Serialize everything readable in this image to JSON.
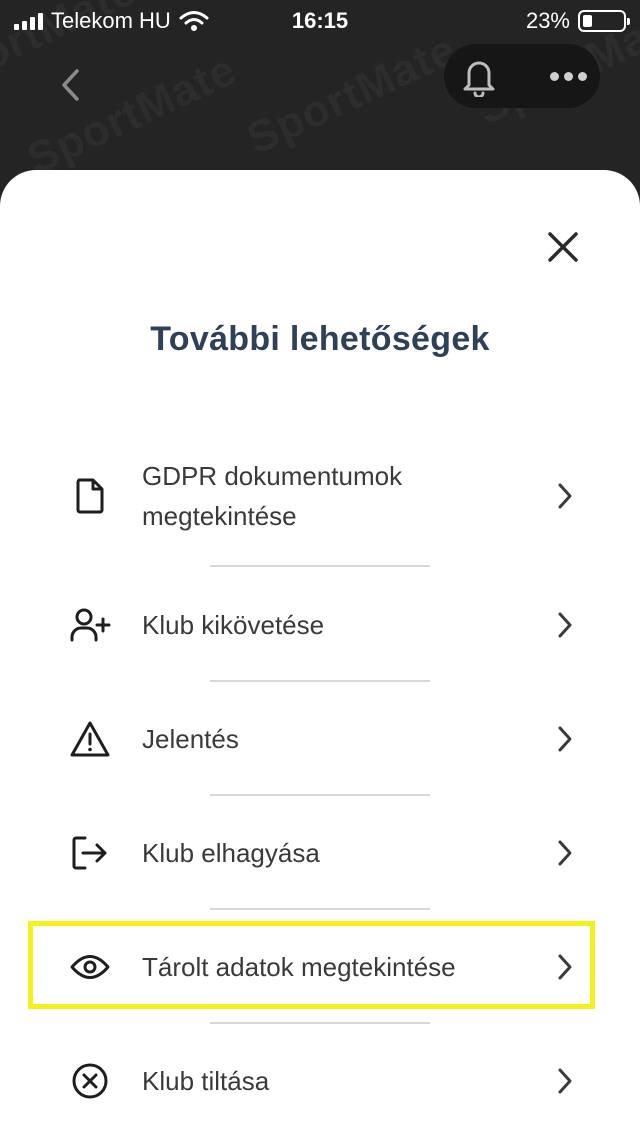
{
  "status_bar": {
    "carrier": "Telekom HU",
    "time": "16:15",
    "battery": "23%"
  },
  "header": {
    "watermark": "SportMate"
  },
  "sheet": {
    "title": "További lehetőségek"
  },
  "menu": {
    "items": [
      {
        "label": "GDPR dokumentumok megtekintése",
        "icon": "document-icon"
      },
      {
        "label": "Klub kikövetése",
        "icon": "user-plus-icon"
      },
      {
        "label": "Jelentés",
        "icon": "warning-icon"
      },
      {
        "label": "Klub elhagyása",
        "icon": "logout-icon"
      },
      {
        "label": "Tárolt adatok megtekintése",
        "icon": "eye-icon",
        "highlighted": true
      },
      {
        "label": "Klub tiltása",
        "icon": "x-circle-icon"
      }
    ]
  },
  "colors": {
    "title": "#2f4059",
    "highlight": "#f4f01a",
    "header_bg": "#242424"
  }
}
